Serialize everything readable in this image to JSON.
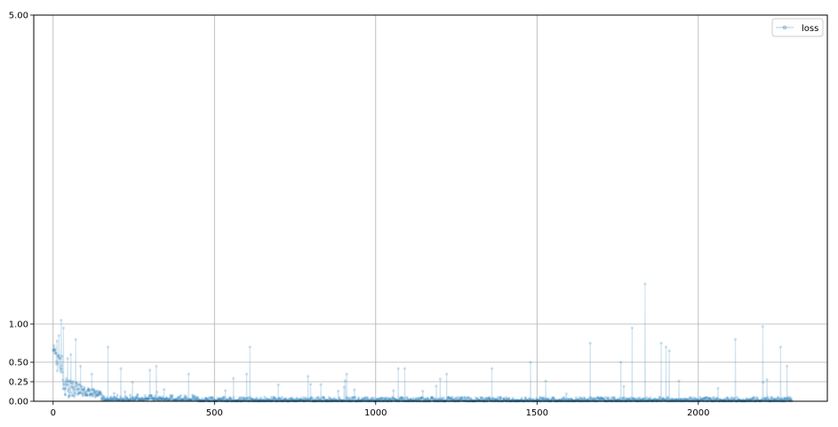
{
  "chart_data": {
    "type": "line",
    "title": "",
    "xlabel": "",
    "ylabel": "",
    "xlim": [
      -60,
      2400
    ],
    "ylim": [
      0,
      5.0
    ],
    "grid": true,
    "x_ticks": [
      0,
      500,
      1000,
      1500,
      2000
    ],
    "x_tick_labels": [
      "0",
      "500",
      "1000",
      "1500",
      "2000"
    ],
    "y_ticks": [
      0,
      0.25,
      0.5,
      1.0,
      5.0
    ],
    "y_tick_labels": [
      "0.00",
      "0.25",
      "0.50",
      "1.00",
      "5.00"
    ],
    "legend": {
      "position": "top-right",
      "entries": [
        "loss"
      ]
    },
    "series": [
      {
        "name": "loss",
        "color": "#1f77b4",
        "alpha": 0.2,
        "marker": "o",
        "x_start": 0,
        "x_end": 2290,
        "values_note": "approximate noisy loss curve: ~0.6-0.75 at start, decays to ~0.02-0.08 by x≈400 with occasional spikes",
        "spikes": [
          [
            3,
            0.72
          ],
          [
            8,
            0.62
          ],
          [
            12,
            0.78
          ],
          [
            18,
            0.85
          ],
          [
            25,
            1.05
          ],
          [
            32,
            0.95
          ],
          [
            45,
            0.55
          ],
          [
            55,
            0.6
          ],
          [
            70,
            0.8
          ],
          [
            85,
            0.45
          ],
          [
            120,
            0.35
          ],
          [
            170,
            0.7
          ],
          [
            210,
            0.42
          ],
          [
            300,
            0.4
          ],
          [
            320,
            0.45
          ],
          [
            420,
            0.35
          ],
          [
            600,
            0.35
          ],
          [
            610,
            0.7
          ],
          [
            790,
            0.32
          ],
          [
            910,
            0.35
          ],
          [
            1070,
            0.42
          ],
          [
            1090,
            0.42
          ],
          [
            1220,
            0.35
          ],
          [
            1360,
            0.42
          ],
          [
            1480,
            0.5
          ],
          [
            1665,
            0.75
          ],
          [
            1760,
            0.5
          ],
          [
            1795,
            0.95
          ],
          [
            1835,
            1.52
          ],
          [
            1885,
            0.75
          ],
          [
            1900,
            0.7
          ],
          [
            1910,
            0.65
          ],
          [
            2115,
            0.8
          ],
          [
            2200,
            0.97
          ],
          [
            2255,
            0.7
          ],
          [
            2275,
            0.45
          ]
        ]
      }
    ]
  }
}
